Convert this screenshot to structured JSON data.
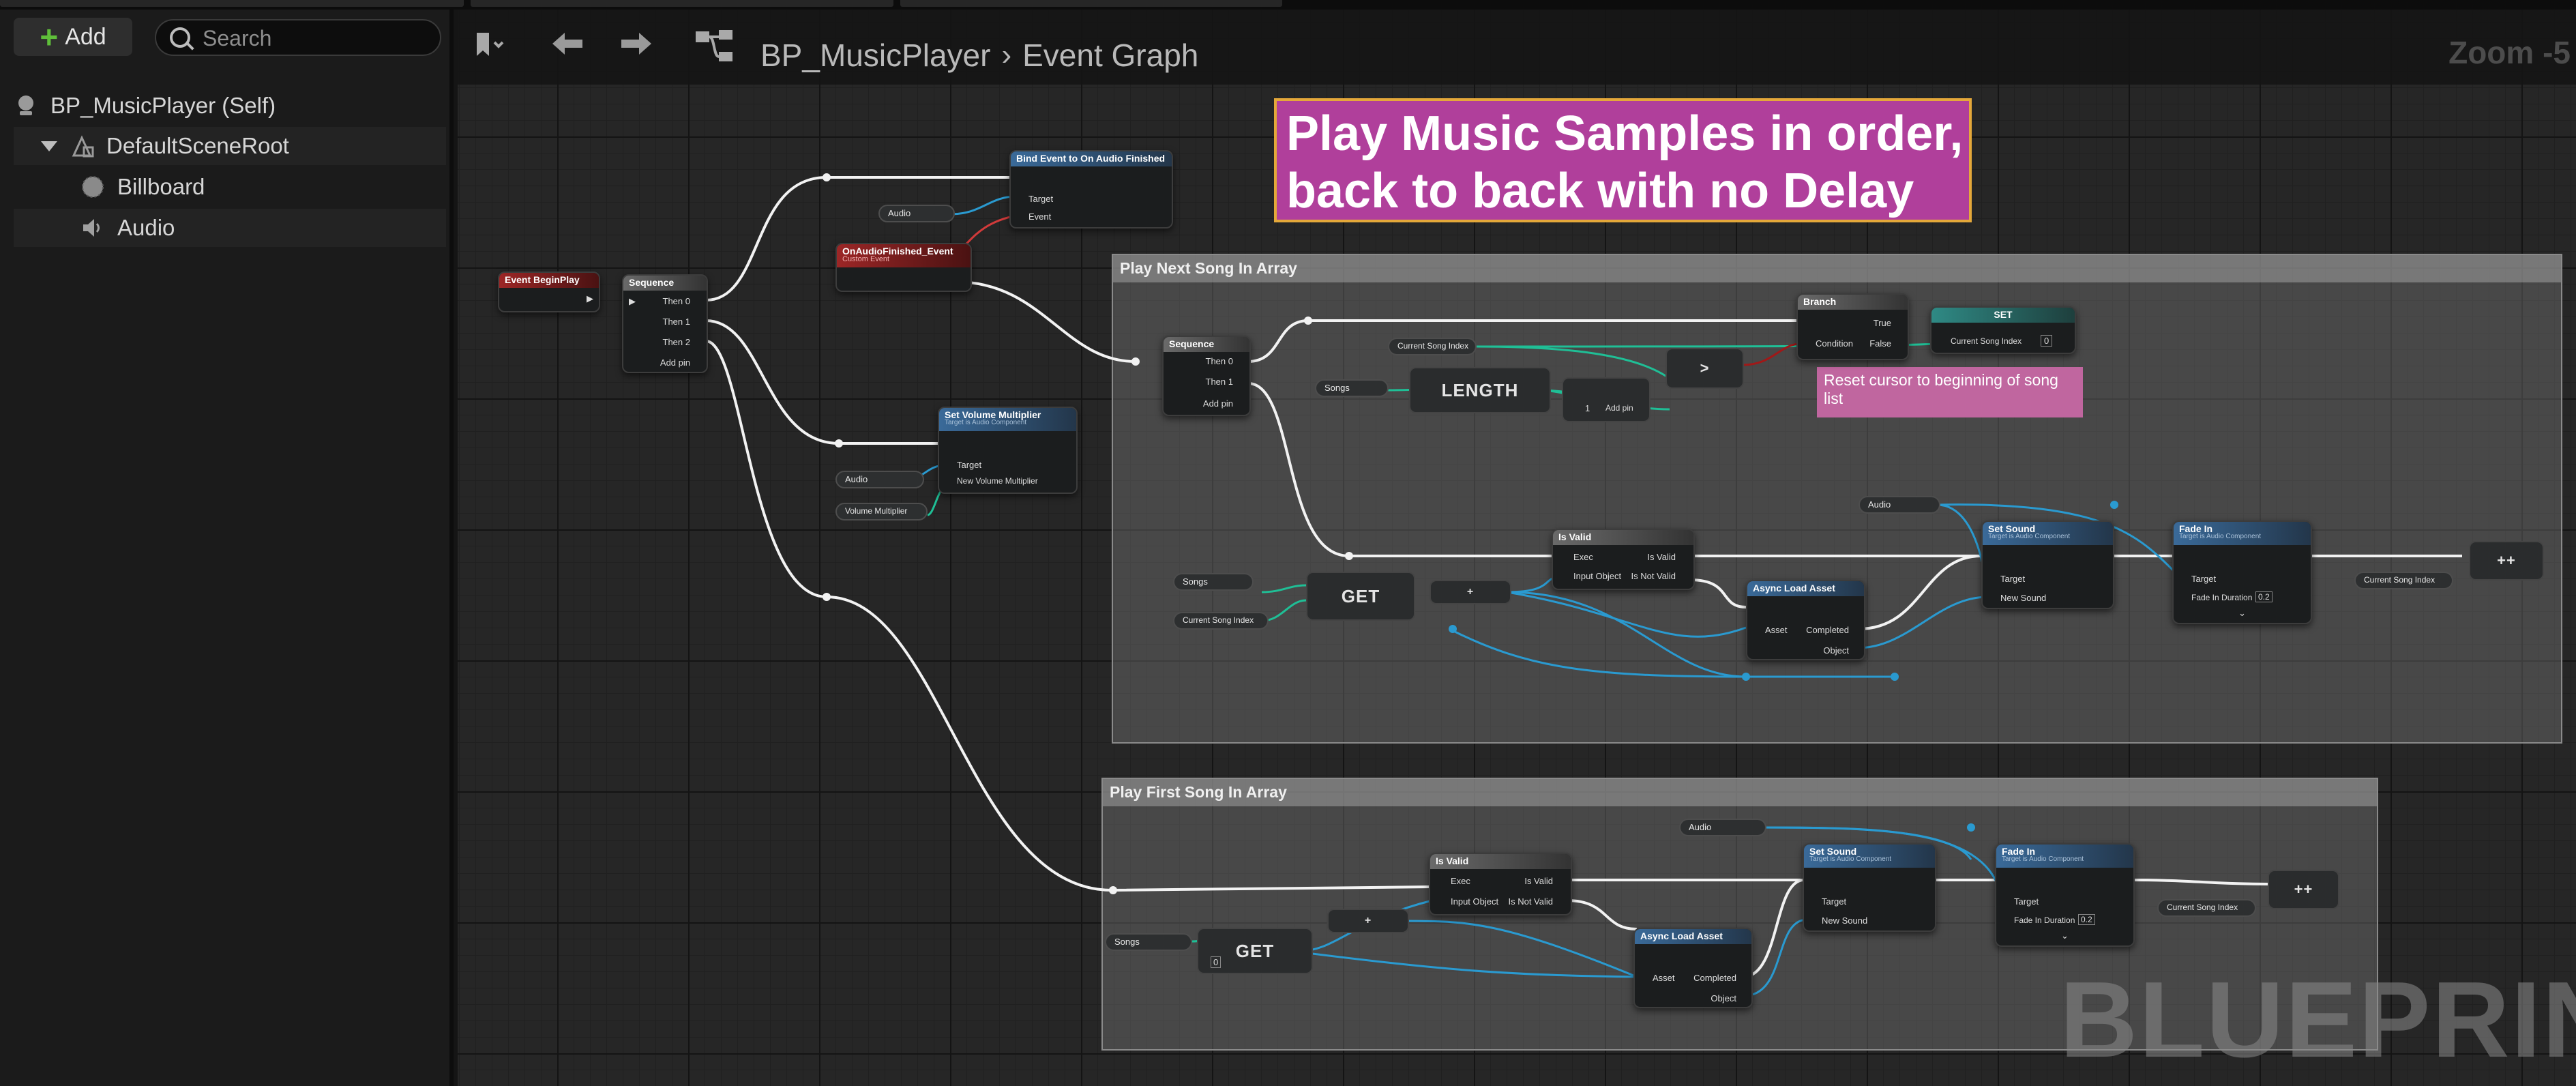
{
  "toolbar": {
    "add_label": "Add",
    "search_placeholder": "Search",
    "zoom": "Zoom -5"
  },
  "breadcrumb": {
    "blueprint": "BP_MusicPlayer",
    "graph": "Event Graph"
  },
  "components": {
    "self": "BP_MusicPlayer (Self)",
    "root": "DefaultSceneRoot",
    "billboard": "Billboard",
    "audio": "Audio"
  },
  "comments": {
    "main": "Play Music Samples in order, back to back with no Delay",
    "next": "Play Next Song In Array",
    "first": "Play First Song In Array",
    "reset": "Reset cursor to beginning of song list"
  },
  "nodes": {
    "begin_play": "Event BeginPlay",
    "sequence": "Sequence",
    "then0": "Then 0",
    "then1": "Then 1",
    "then2": "Then 2",
    "add_pin": "Add pin",
    "bind_event": "Bind Event to On Audio Finished",
    "target": "Target",
    "event": "Event",
    "custom_event": "OnAudioFinished_Event",
    "custom_event_sub": "Custom Event",
    "set_volume": "Set Volume Multiplier",
    "set_volume_sub": "Target is Audio Component",
    "new_volume": "New Volume Multiplier",
    "volume_var": "Volume Multiplier",
    "audio_var": "Audio",
    "songs_var": "Songs",
    "current_song_index": "Current Song Index",
    "length": "LENGTH",
    "get": "GET",
    "branch": "Branch",
    "true": "True",
    "false": "False",
    "condition": "Condition",
    "set": "SET",
    "is_valid": "Is Valid",
    "exec": "Exec",
    "is_valid_pin": "Is Valid",
    "input_object": "Input Object",
    "is_not_valid": "Is Not Valid",
    "async_load": "Async Load Asset",
    "asset": "Asset",
    "completed": "Completed",
    "object": "Object",
    "set_sound": "Set Sound",
    "set_sound_sub": "Target is Audio Component",
    "new_sound": "New Sound",
    "fade_in": "Fade In",
    "fade_in_sub": "Target is Audio Component",
    "fade_duration_label": "Fade In Duration",
    "fade_duration": "0.2",
    "increment": "++",
    "plus": "+",
    "compare": ">",
    "zero": "0",
    "one": "1"
  },
  "watermark": "BLUEPRINT"
}
